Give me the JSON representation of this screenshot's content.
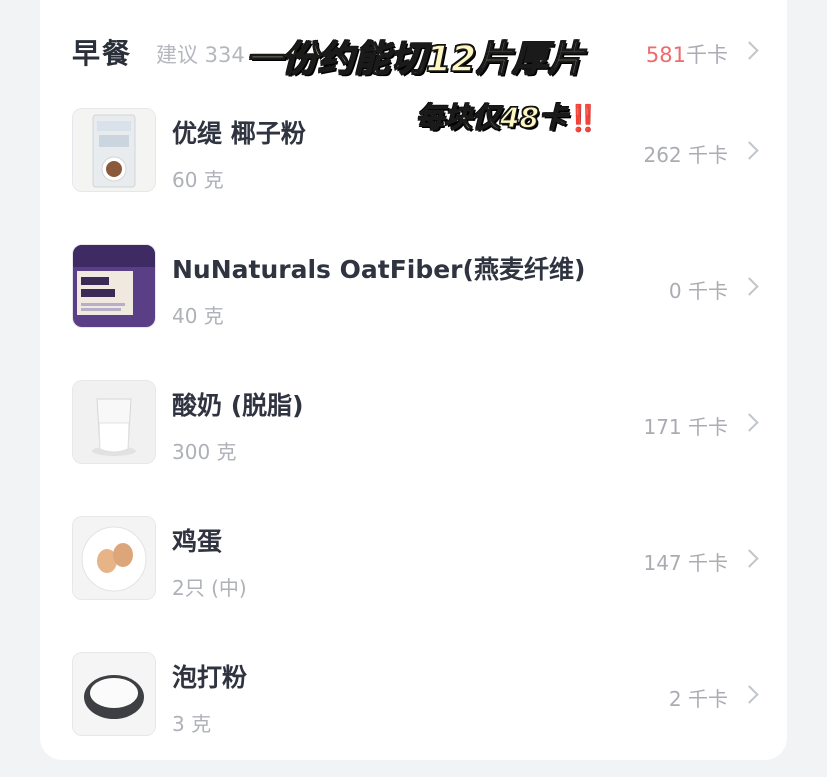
{
  "meal": {
    "title": "早餐",
    "suggest": "建议 334",
    "total_value": "581",
    "total_unit": "千卡"
  },
  "overlay": {
    "line1": "一份约能切12片厚片",
    "line2": "每块仅48卡",
    "line2_mark": "‼️"
  },
  "items": [
    {
      "name": "优缇 椰子粉",
      "qty": "60 克",
      "kcal": "262 千卡",
      "icon": "coconut-flour-bag-photo"
    },
    {
      "name": "NuNaturals OatFiber(燕麦纤维)",
      "qty": "40 克",
      "kcal": "0 千卡",
      "icon": "oat-fiber-bag-photo"
    },
    {
      "name": "酸奶 (脱脂)",
      "qty": "300 克",
      "kcal": "171 千卡",
      "icon": "yogurt-glass-photo"
    },
    {
      "name": "鸡蛋",
      "qty": "2只 (中)",
      "kcal": "147 千卡",
      "icon": "eggs-plate-photo"
    },
    {
      "name": "泡打粉",
      "qty": "3 克",
      "kcal": "2 千卡",
      "icon": "baking-powder-bowl-photo"
    }
  ],
  "colors": {
    "total_highlight": "#ef6b6b",
    "overlay_text": "#fff7c2",
    "muted_text": "#a9acb2"
  }
}
